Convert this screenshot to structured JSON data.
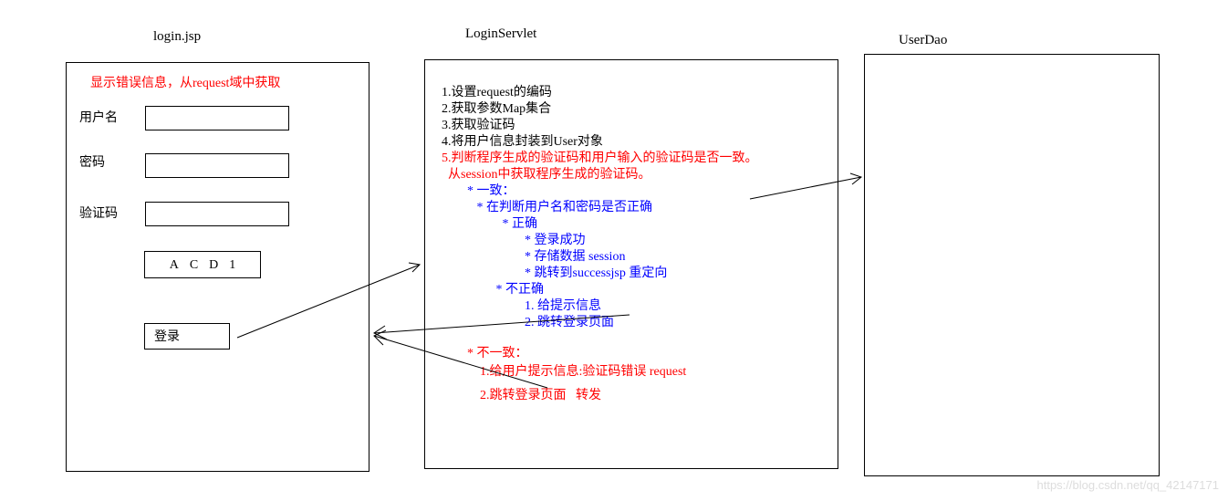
{
  "titles": {
    "login": "login.jsp",
    "servlet": "LoginServlet",
    "dao": "UserDao"
  },
  "login_box": {
    "error_msg": "显示错误信息，从request域中获取",
    "user_label": "用户名",
    "pass_label": "密码",
    "captcha_label": "验证码",
    "captcha_value": "ACD1",
    "login_btn": "登录"
  },
  "servlet_lines": {
    "l1": "1.设置request的编码",
    "l2": "2.获取参数Map集合",
    "l3": "3.获取验证码",
    "l4": "4.将用户信息封装到User对象",
    "l5": "5.判断程序生成的验证码和用户输入的验证码是否一致。",
    "l5b": "  从session中获取程序生成的验证码。",
    "l6": "        * 一致：",
    "l7": "           * 在判断用户名和密码是否正确",
    "l8": "                   * 正确",
    "l9": "                          * 登录成功",
    "l10": "                          * 存储数据 session",
    "l11": "                          * 跳转到successjsp 重定向",
    "l12": "                 * 不正确",
    "l13": "                          1. 给提示信息",
    "l14": "                          2. 跳转登录页面",
    "l15": "        * 不一致：",
    "l16": "            1.给用户提示信息:验证码错误 request",
    "l17": "            2.跳转登录页面   转发"
  },
  "watermark": "https://blog.csdn.net/qq_42147171"
}
